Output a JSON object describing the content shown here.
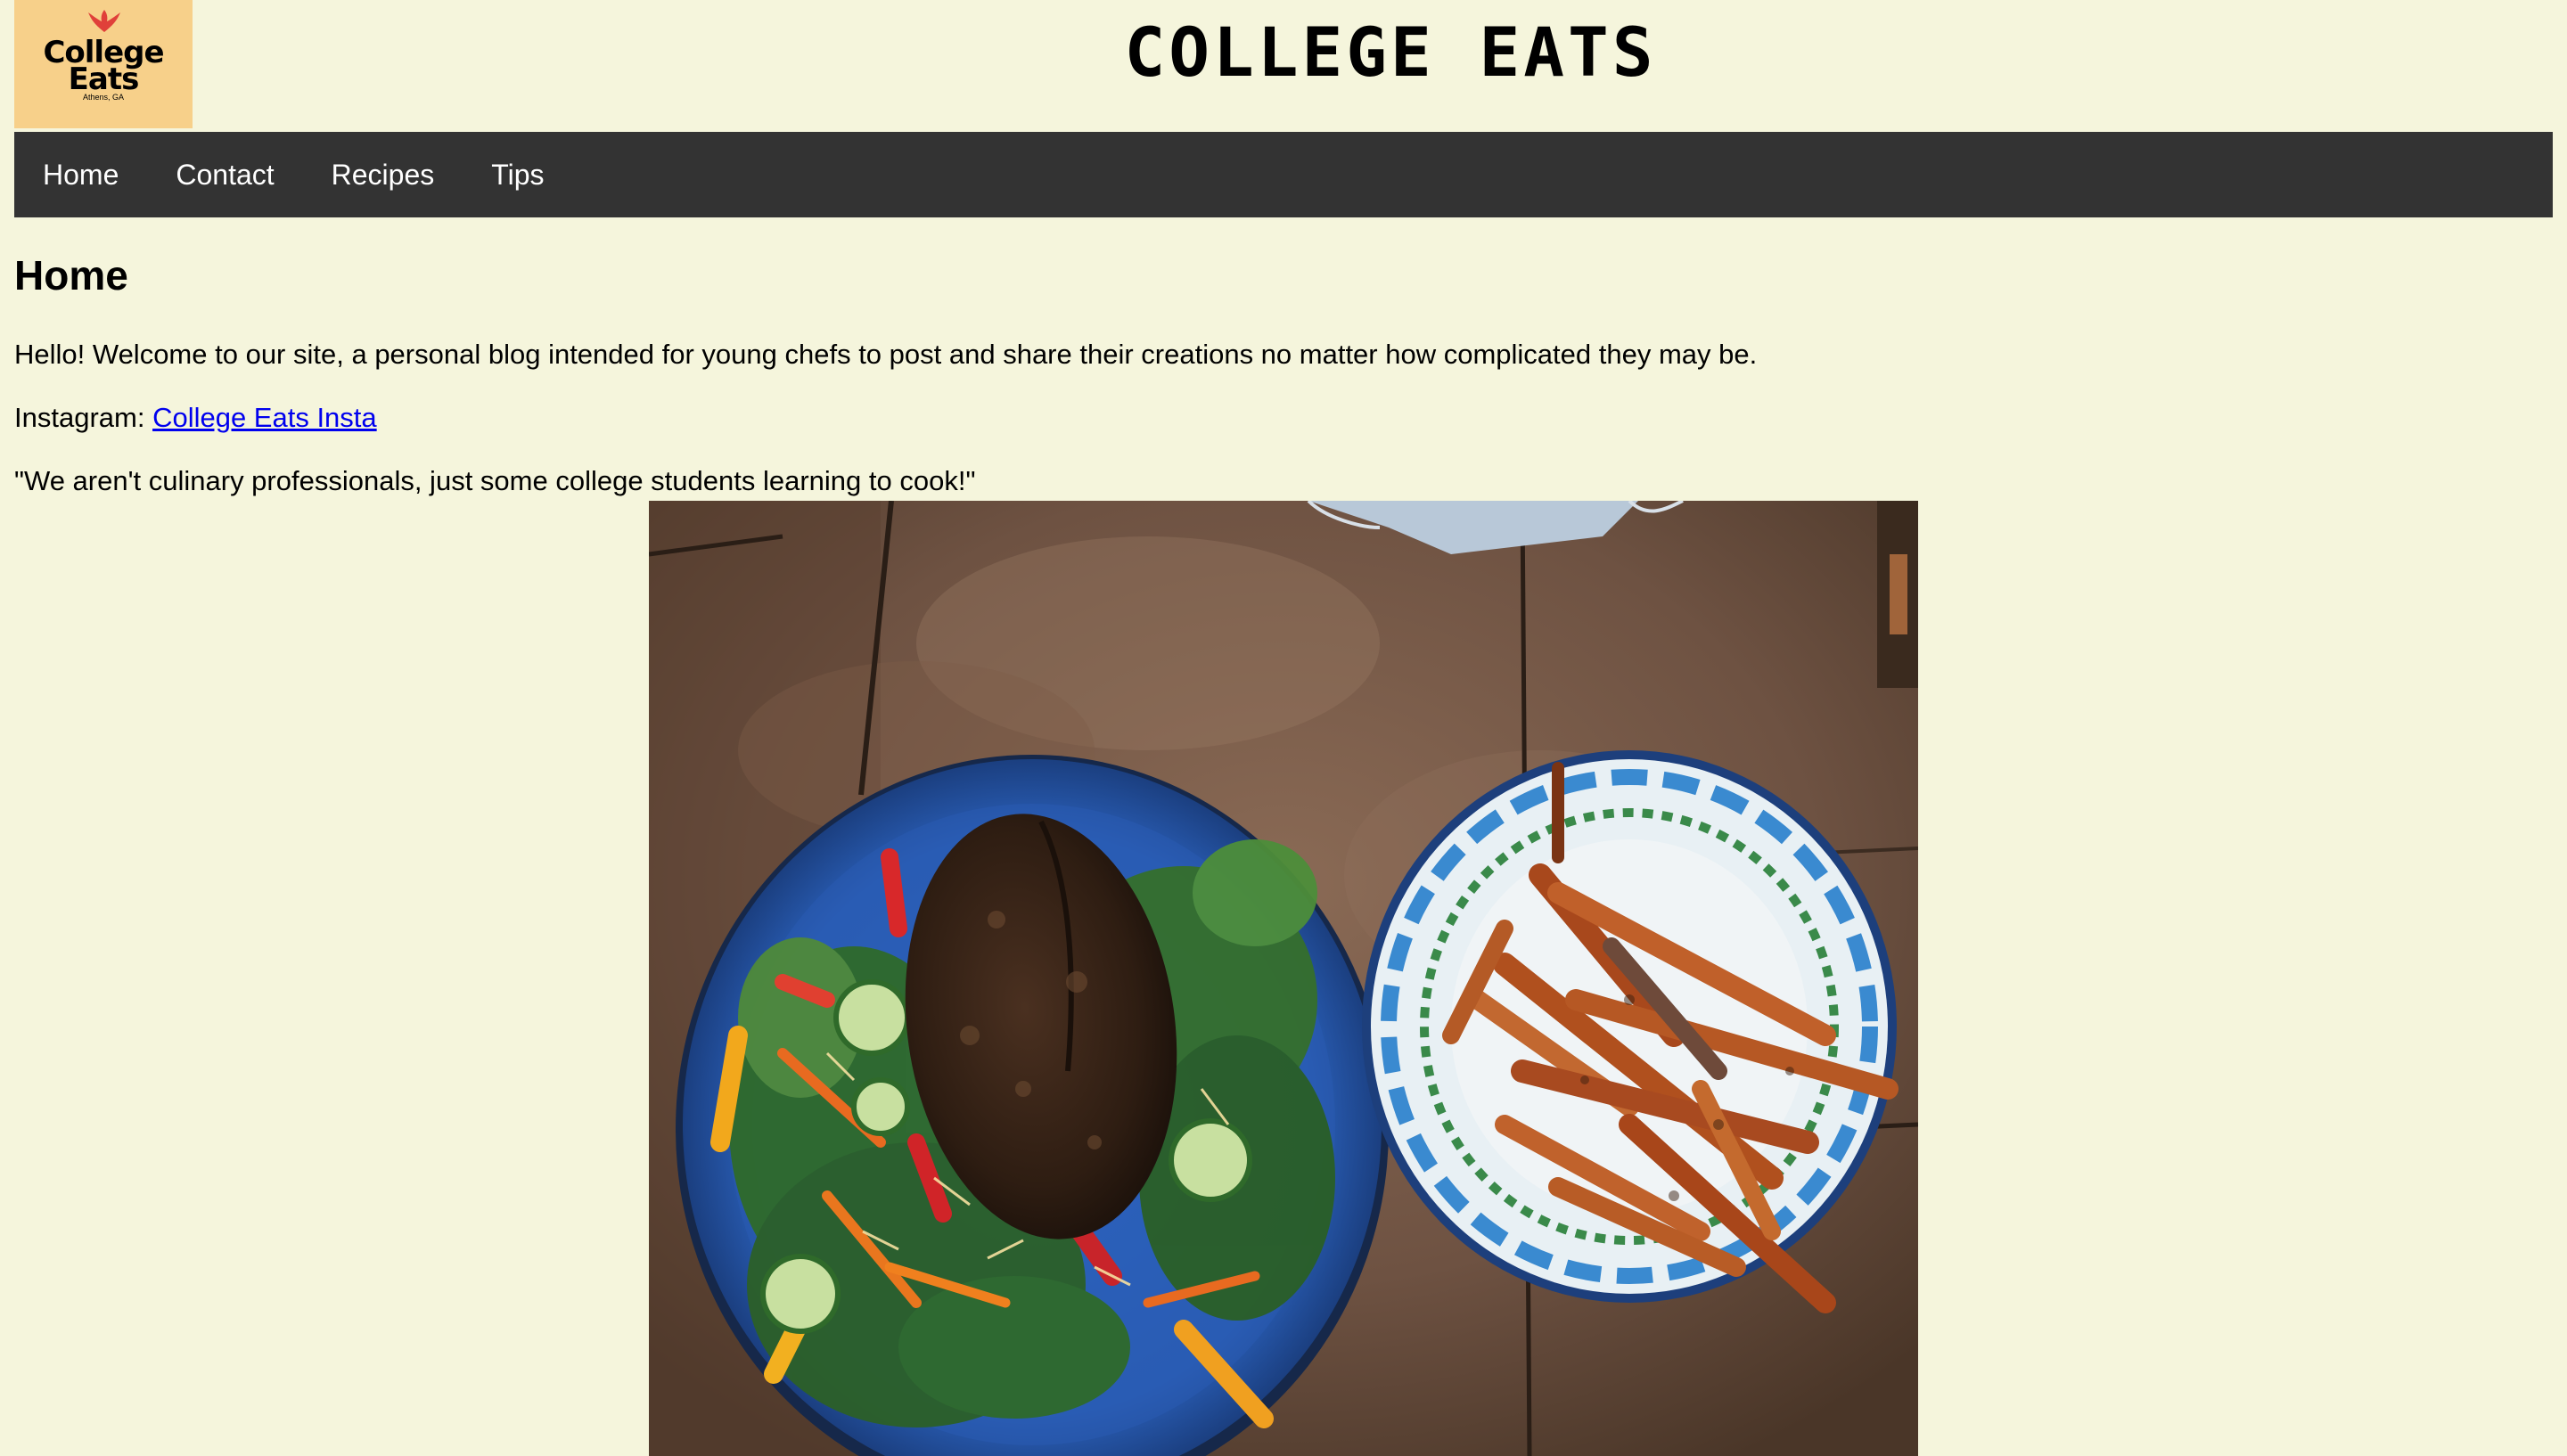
{
  "logo": {
    "line1": "College",
    "line2": "Eats",
    "line3": "Athens, GA",
    "background": "#f7d08a",
    "bird_color": "#e0403a"
  },
  "site_title": "COLLEGE EATS",
  "nav": {
    "background": "#333333",
    "items": [
      {
        "label": "Home"
      },
      {
        "label": "Contact"
      },
      {
        "label": "Recipes"
      },
      {
        "label": "Tips"
      }
    ]
  },
  "main": {
    "heading": "Home",
    "welcome": "Hello! Welcome to our site, a personal blog intended for young chefs to post and share their creations no matter how complicated they may be.",
    "instagram_label": "Instagram: ",
    "instagram_link": "College Eats Insta",
    "quote": "\"We aren't culinary professionals, just some college students learning to cook!\""
  },
  "photo": {
    "icon": "food-photo",
    "subjects": [
      "salad plate with blackened chicken",
      "sweet potato fries plate"
    ]
  },
  "colors": {
    "page_background": "#f5f5dc",
    "link": "#0000ee"
  }
}
